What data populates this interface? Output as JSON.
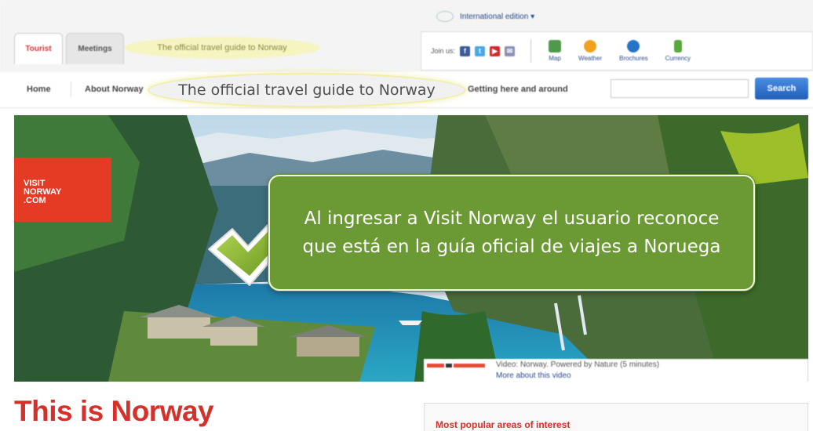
{
  "header": {
    "edition": "International edition ▾",
    "tabs": [
      "Tourist",
      "Meetings"
    ],
    "tagline_small": "The official travel guide to Norway",
    "join_us": "Join us:",
    "social": [
      {
        "icon": "facebook-icon",
        "glyph": "f",
        "color": "#3b5b9a"
      },
      {
        "icon": "twitter-icon",
        "glyph": "t",
        "color": "#4aa8e6"
      },
      {
        "icon": "youtube-icon",
        "glyph": "▶",
        "color": "#d02a2a"
      },
      {
        "icon": "email-icon",
        "glyph": "✉",
        "color": "#8c8fb6"
      }
    ],
    "tools": [
      {
        "label": "Map",
        "icon": "map-icon",
        "color": "#4f9a4a"
      },
      {
        "label": "Weather",
        "icon": "weather-icon",
        "color": "#f0a21e"
      },
      {
        "label": "Brochures",
        "icon": "brochures-icon",
        "color": "#2774c6"
      },
      {
        "label": "Currency",
        "icon": "currency-icon",
        "color": "#58a83a"
      }
    ]
  },
  "nav": {
    "items": [
      "Home",
      "About Norway",
      "Getting here and around"
    ],
    "tagline": "The official travel guide to Norway",
    "search_label": "Search"
  },
  "hero": {
    "logo_lines": [
      "VISIT",
      "NORWAY",
      ".COM"
    ],
    "video_title": "Video: Norway. Powered by Nature (5 minutes)",
    "video_more": "More about this video"
  },
  "callout": {
    "text": "Al ingresar a Visit Norway el usuario reconoce que está en la guía oficial de viajes a Noruega"
  },
  "main": {
    "heading": "This is Norway",
    "popular": "Most popular areas of interest"
  },
  "colors": {
    "brand_red": "#d6302a",
    "callout_green": "#6b9a35",
    "link_blue": "#2a4a8a"
  }
}
